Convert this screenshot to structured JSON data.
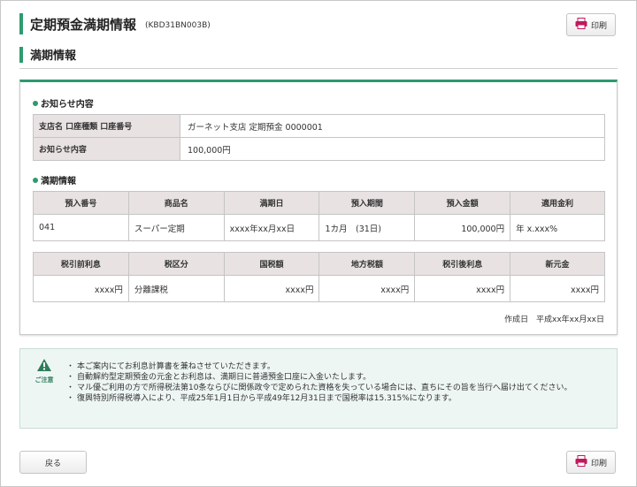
{
  "header": {
    "title": "定期預金満期情報",
    "code": "(KBD31BN003B)",
    "print_label": "印刷"
  },
  "section_title": "満期情報",
  "notice_section": {
    "heading": "お知らせ内容",
    "rows": [
      {
        "label": "支店名 口座種類 口座番号",
        "value": "ガーネット支店 定期預金 0000001"
      },
      {
        "label": "お知らせ内容",
        "value": "100,000円"
      }
    ]
  },
  "maturity_section": {
    "heading": "満期情報",
    "table1": {
      "headers": [
        "預入番号",
        "商品名",
        "満期日",
        "預入期間",
        "預入金額",
        "適用金利"
      ],
      "row": [
        "041",
        "スーパー定期",
        "xxxx年xx月xx日",
        "1カ月　(31日)",
        "100,000円",
        "年 x.xxx%"
      ]
    },
    "table2": {
      "headers": [
        "税引前利息",
        "税区分",
        "国税額",
        "地方税額",
        "税引後利息",
        "新元金"
      ],
      "row": [
        "xxxx円",
        "分離課税",
        "xxxx円",
        "xxxx円",
        "xxxx円",
        "xxxx円"
      ]
    },
    "created_label": "作成日",
    "created_date": "平成xx年xx月xx日"
  },
  "caution": {
    "label": "ご注意",
    "items": [
      "本ご案内にてお利息計算書を兼ねさせていただきます。",
      "自動解約型定期預金の元金とお利息は、満期日に普通預金口座に入金いたします。",
      "マル優ご利用の方で所得税法第10条ならびに関係政令で定められた資格を失っている場合には、直ちにその旨を当行へ届け出てください。",
      "復興特別所得税導入により、平成25年1月1日から平成49年12月31日まで国税率は15.315%になります。"
    ]
  },
  "footer": {
    "back_label": "戻る",
    "print_label": "印刷"
  },
  "colors": {
    "accent": "#2e9a6e",
    "header_cell": "#e8e2e2",
    "print_icon": "#c2185b"
  }
}
